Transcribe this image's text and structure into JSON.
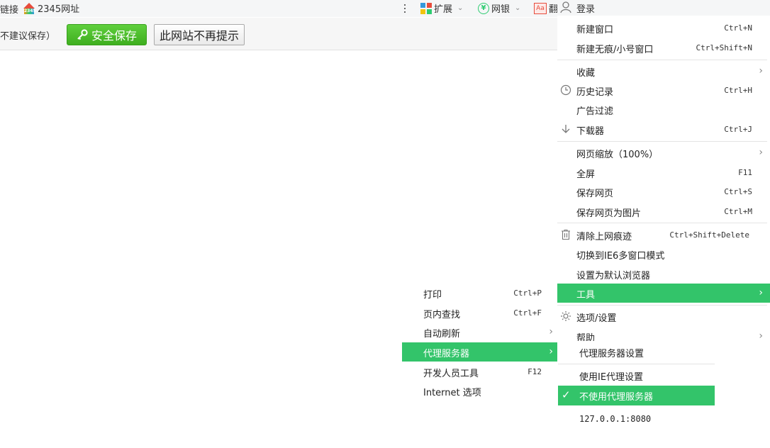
{
  "bookmarks_bar": {
    "item_connect": "链接",
    "item_2345": "2345网址",
    "logo_2345_text": "2345"
  },
  "toolbar": {
    "extensions_label": "扩展",
    "netbank_label": "网银",
    "dict_label": "翻",
    "icons": [
      "more-dots-icon",
      "extensions-grid-icon",
      "netbank-icon",
      "dictionary-icon",
      "user-icon"
    ]
  },
  "infobar": {
    "text": "不建议保存）",
    "safe_save_label": "安全保存",
    "no_prompt_label": "此网站不再提示"
  },
  "main_menu": {
    "login_label": "登录",
    "items": [
      {
        "label": "新建窗口",
        "shortcut": "Ctrl+N"
      },
      {
        "label": "新建无痕/小号窗口",
        "shortcut": "Ctrl+Shift+N"
      },
      {
        "label": "收藏",
        "shortcut": ""
      },
      {
        "label": "历史记录",
        "shortcut": "Ctrl+H"
      },
      {
        "label": "广告过滤",
        "shortcut": ""
      },
      {
        "label": "下载器",
        "shortcut": "Ctrl+J"
      },
      {
        "label": "网页缩放（100%）",
        "shortcut": ""
      },
      {
        "label": "全屏",
        "shortcut": "F11"
      },
      {
        "label": "保存网页",
        "shortcut": "Ctrl+S"
      },
      {
        "label": "保存网页为图片",
        "shortcut": "Ctrl+M"
      },
      {
        "label": "清除上网痕迹",
        "shortcut": "Ctrl+Shift+Delete"
      },
      {
        "label": "切换到IE6多窗口模式",
        "shortcut": ""
      },
      {
        "label": "设置为默认浏览器",
        "shortcut": ""
      },
      {
        "label": "工具",
        "shortcut": ""
      },
      {
        "label": "选项/设置",
        "shortcut": ""
      },
      {
        "label": "帮助",
        "shortcut": ""
      }
    ]
  },
  "tools_submenu": {
    "items": [
      {
        "label": "打印",
        "shortcut": "Ctrl+P"
      },
      {
        "label": "页内查找",
        "shortcut": "Ctrl+F"
      },
      {
        "label": "自动刷新",
        "shortcut": ""
      },
      {
        "label": "代理服务器",
        "shortcut": ""
      },
      {
        "label": "开发人员工具",
        "shortcut": "F12"
      },
      {
        "label": "Internet 选项",
        "shortcut": ""
      }
    ]
  },
  "proxy_submenu": {
    "items": [
      {
        "label": "代理服务器设置"
      },
      {
        "label": "使用IE代理设置"
      },
      {
        "label": "不使用代理服务器"
      },
      {
        "label": "127.0.0.1:8080"
      }
    ]
  },
  "colors": {
    "highlight": "#33c46a",
    "save_button": "#4cbf2a"
  }
}
